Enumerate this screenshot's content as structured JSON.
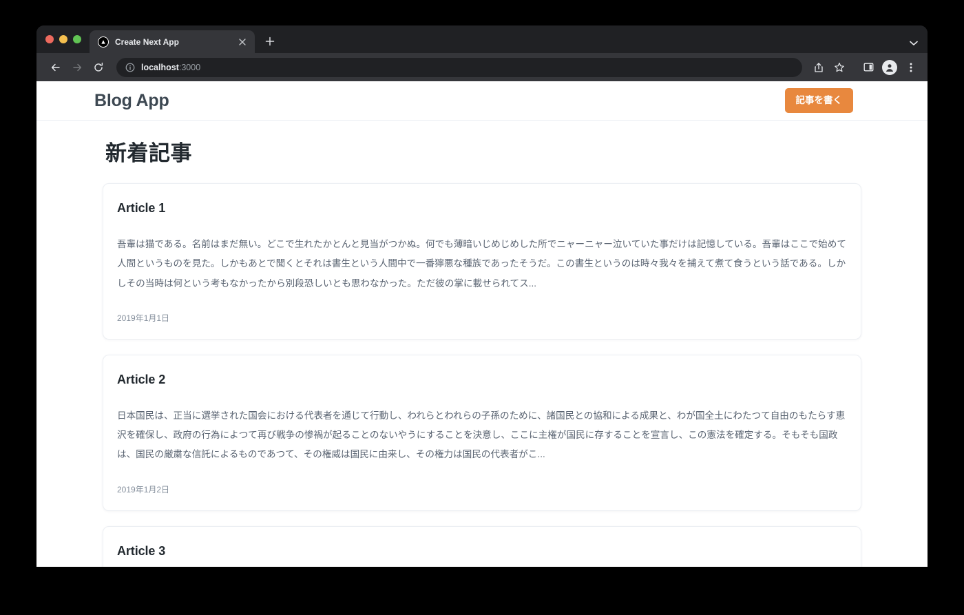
{
  "browser": {
    "tab": {
      "title": "Create Next App",
      "favicon_icon": "nextjs-triangle-icon",
      "close_icon": "close-icon"
    },
    "new_tab_icon": "plus-icon",
    "tabstrip_chevron_icon": "chevron-down-icon",
    "toolbar": {
      "back_icon": "back-arrow-icon",
      "forward_icon": "forward-arrow-icon",
      "reload_icon": "reload-icon",
      "site_info_icon": "info-circle-icon",
      "url_host": "localhost",
      "url_port": ":3000",
      "share_icon": "share-icon",
      "bookmark_icon": "star-icon",
      "sidebar_icon": "sidebar-panel-icon",
      "profile_icon": "profile-avatar-icon",
      "menu_icon": "three-dot-menu-icon"
    }
  },
  "site": {
    "brand": "Blog App",
    "write_button_label": "記事を書く",
    "page_title": "新着記事",
    "accent_color": "#e8883e",
    "brand_color": "#3d4852",
    "articles": [
      {
        "title": "Article 1",
        "body": "吾輩は猫である。名前はまだ無い。どこで生れたかとんと見当がつかぬ。何でも薄暗いじめじめした所でニャーニャー泣いていた事だけは記憶している。吾輩はここで始めて人間というものを見た。しかもあとで聞くとそれは書生という人間中で一番獰悪な種族であったそうだ。この書生というのは時々我々を捕えて煮て食うという話である。しかしその当時は何という考もなかったから別段恐しいとも思わなかった。ただ彼の掌に載せられてス...",
        "date": "2019年1月1日"
      },
      {
        "title": "Article 2",
        "body": "日本国民は、正当に選挙された国会における代表者を通じて行動し、われらとわれらの子孫のために、諸国民との協和による成果と、わが国全土にわたつて自由のもたらす恵沢を確保し、政府の行為によつて再び戦争の惨禍が起ることのないやうにすることを決意し、ここに主権が国民に存することを宣言し、この憲法を確定する。そもそも国政は、国民の厳粛な信託によるものであつて、その権威は国民に由来し、その権力は国民の代表者がこ...",
        "date": "2019年1月2日"
      },
      {
        "title": "Article 3",
        "body": "",
        "date": ""
      }
    ]
  }
}
